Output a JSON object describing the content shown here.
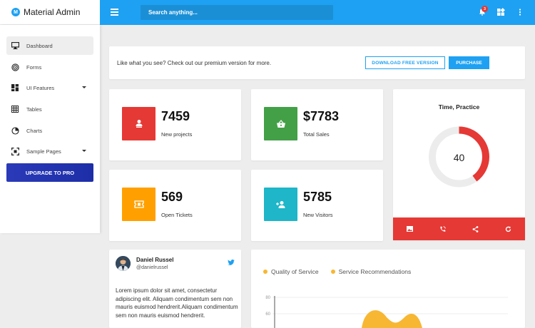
{
  "brand": {
    "logo_letter": "M",
    "name": "Material Admin"
  },
  "topbar": {
    "search_placeholder": "Search anything...",
    "notification_count": "3",
    "icons": [
      "menu-icon",
      "bell-icon",
      "apps-icon",
      "more-vert-icon"
    ]
  },
  "sidebar": {
    "items": [
      {
        "label": "Dashboard",
        "icon": "monitor-icon",
        "active": true
      },
      {
        "label": "Forms",
        "icon": "target-icon"
      },
      {
        "label": "UI Features",
        "icon": "grid-icon",
        "has_submenu": true
      },
      {
        "label": "Tables",
        "icon": "table-icon"
      },
      {
        "label": "Charts",
        "icon": "pie-icon"
      },
      {
        "label": "Sample Pages",
        "icon": "pages-icon",
        "has_submenu": true
      }
    ],
    "upgrade_label": "UPGRADE TO PRO"
  },
  "promo": {
    "text": "Like what you see? Check out our premium version for more.",
    "download_label": "DOWNLOAD FREE VERSION",
    "purchase_label": "PURCHASE"
  },
  "stats": [
    {
      "value": "7459",
      "label": "New projects",
      "color": "#e53935",
      "icon": "team-icon"
    },
    {
      "value": "$7783",
      "label": "Total Sales",
      "color": "#43a047",
      "icon": "basket-icon"
    },
    {
      "value": "569",
      "label": "Open Tickets",
      "color": "#ffa000",
      "icon": "ticket-icon"
    },
    {
      "value": "5785",
      "label": "New Visitors",
      "color": "#1eb6c8",
      "icon": "add-user-icon"
    }
  ],
  "time_practice": {
    "title": "Time, Practice",
    "value": "40",
    "progress_fraction": 0.4,
    "accent": "#e53935",
    "actions": [
      "image-icon",
      "phone-icon",
      "share-icon",
      "refresh-icon"
    ]
  },
  "profile": {
    "name": "Daniel Russel",
    "handle": "@danielrussel",
    "body": "Lorem ipsum dolor sit amet, consectetur adipiscing elit. Aliquam condimentum sem non mauris euismod hendrerit.Aliquam condimentum sem non mauris euismod hendrerit."
  },
  "chart_data": {
    "type": "area",
    "series": [
      {
        "name": "Quality of Service",
        "color": "#f7b733"
      },
      {
        "name": "Service Recommendations",
        "color": "#f7b733"
      }
    ],
    "y_ticks": [
      "80",
      "60"
    ]
  }
}
